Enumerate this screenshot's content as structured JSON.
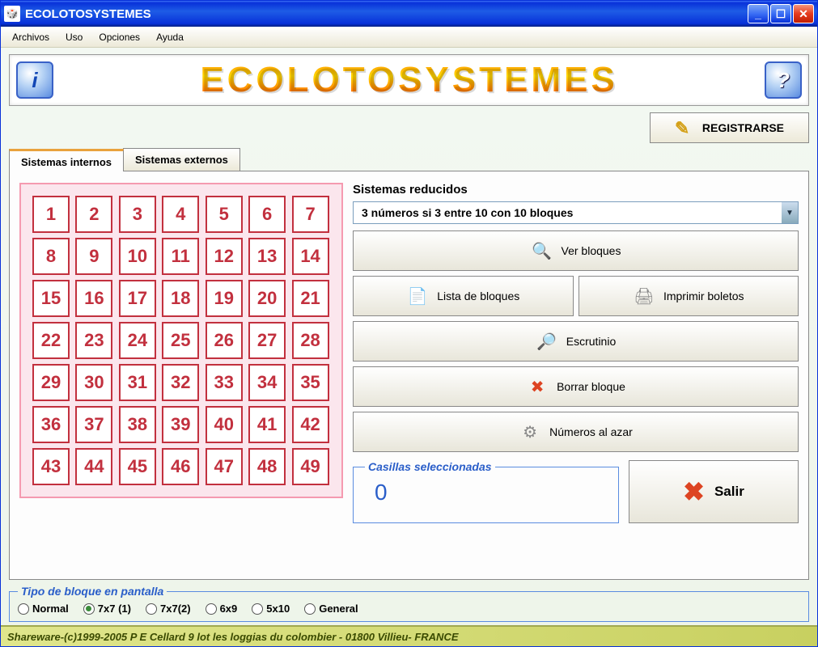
{
  "window": {
    "title": "ECOLOTOSYSTEMES"
  },
  "menu": {
    "archivos": "Archivos",
    "uso": "Uso",
    "opciones": "Opciones",
    "ayuda": "Ayuda"
  },
  "banner": {
    "text": "ECOLOTOSYSTEMES",
    "info": "i",
    "help": "?"
  },
  "register": {
    "label": "REGISTRARSE"
  },
  "tabs": {
    "internal": "Sistemas internos",
    "external": "Sistemas externos"
  },
  "grid": {
    "count": 49
  },
  "reduced": {
    "title": "Sistemas reducidos",
    "combo": "3 números si  3 entre 10 con   10 bloques",
    "ver": "Ver bloques",
    "lista": "Lista de bloques",
    "imprimir": "Imprimir boletos",
    "escrutinio": "Escrutinio",
    "borrar": "Borrar bloque",
    "azar": "Números al azar"
  },
  "selected": {
    "legend": "Casillas seleccionadas",
    "value": "0"
  },
  "exit": {
    "label": "Salir"
  },
  "blocktype": {
    "legend": "Tipo de bloque en pantalla",
    "options": [
      "Normal",
      "7x7 (1)",
      "7x7(2)",
      "6x9",
      "5x10",
      "General"
    ],
    "selected": 1
  },
  "status": "Shareware-(c)1999-2005 P E Cellard 9 lot les loggias du colombier - 01800 Villieu- FRANCE"
}
